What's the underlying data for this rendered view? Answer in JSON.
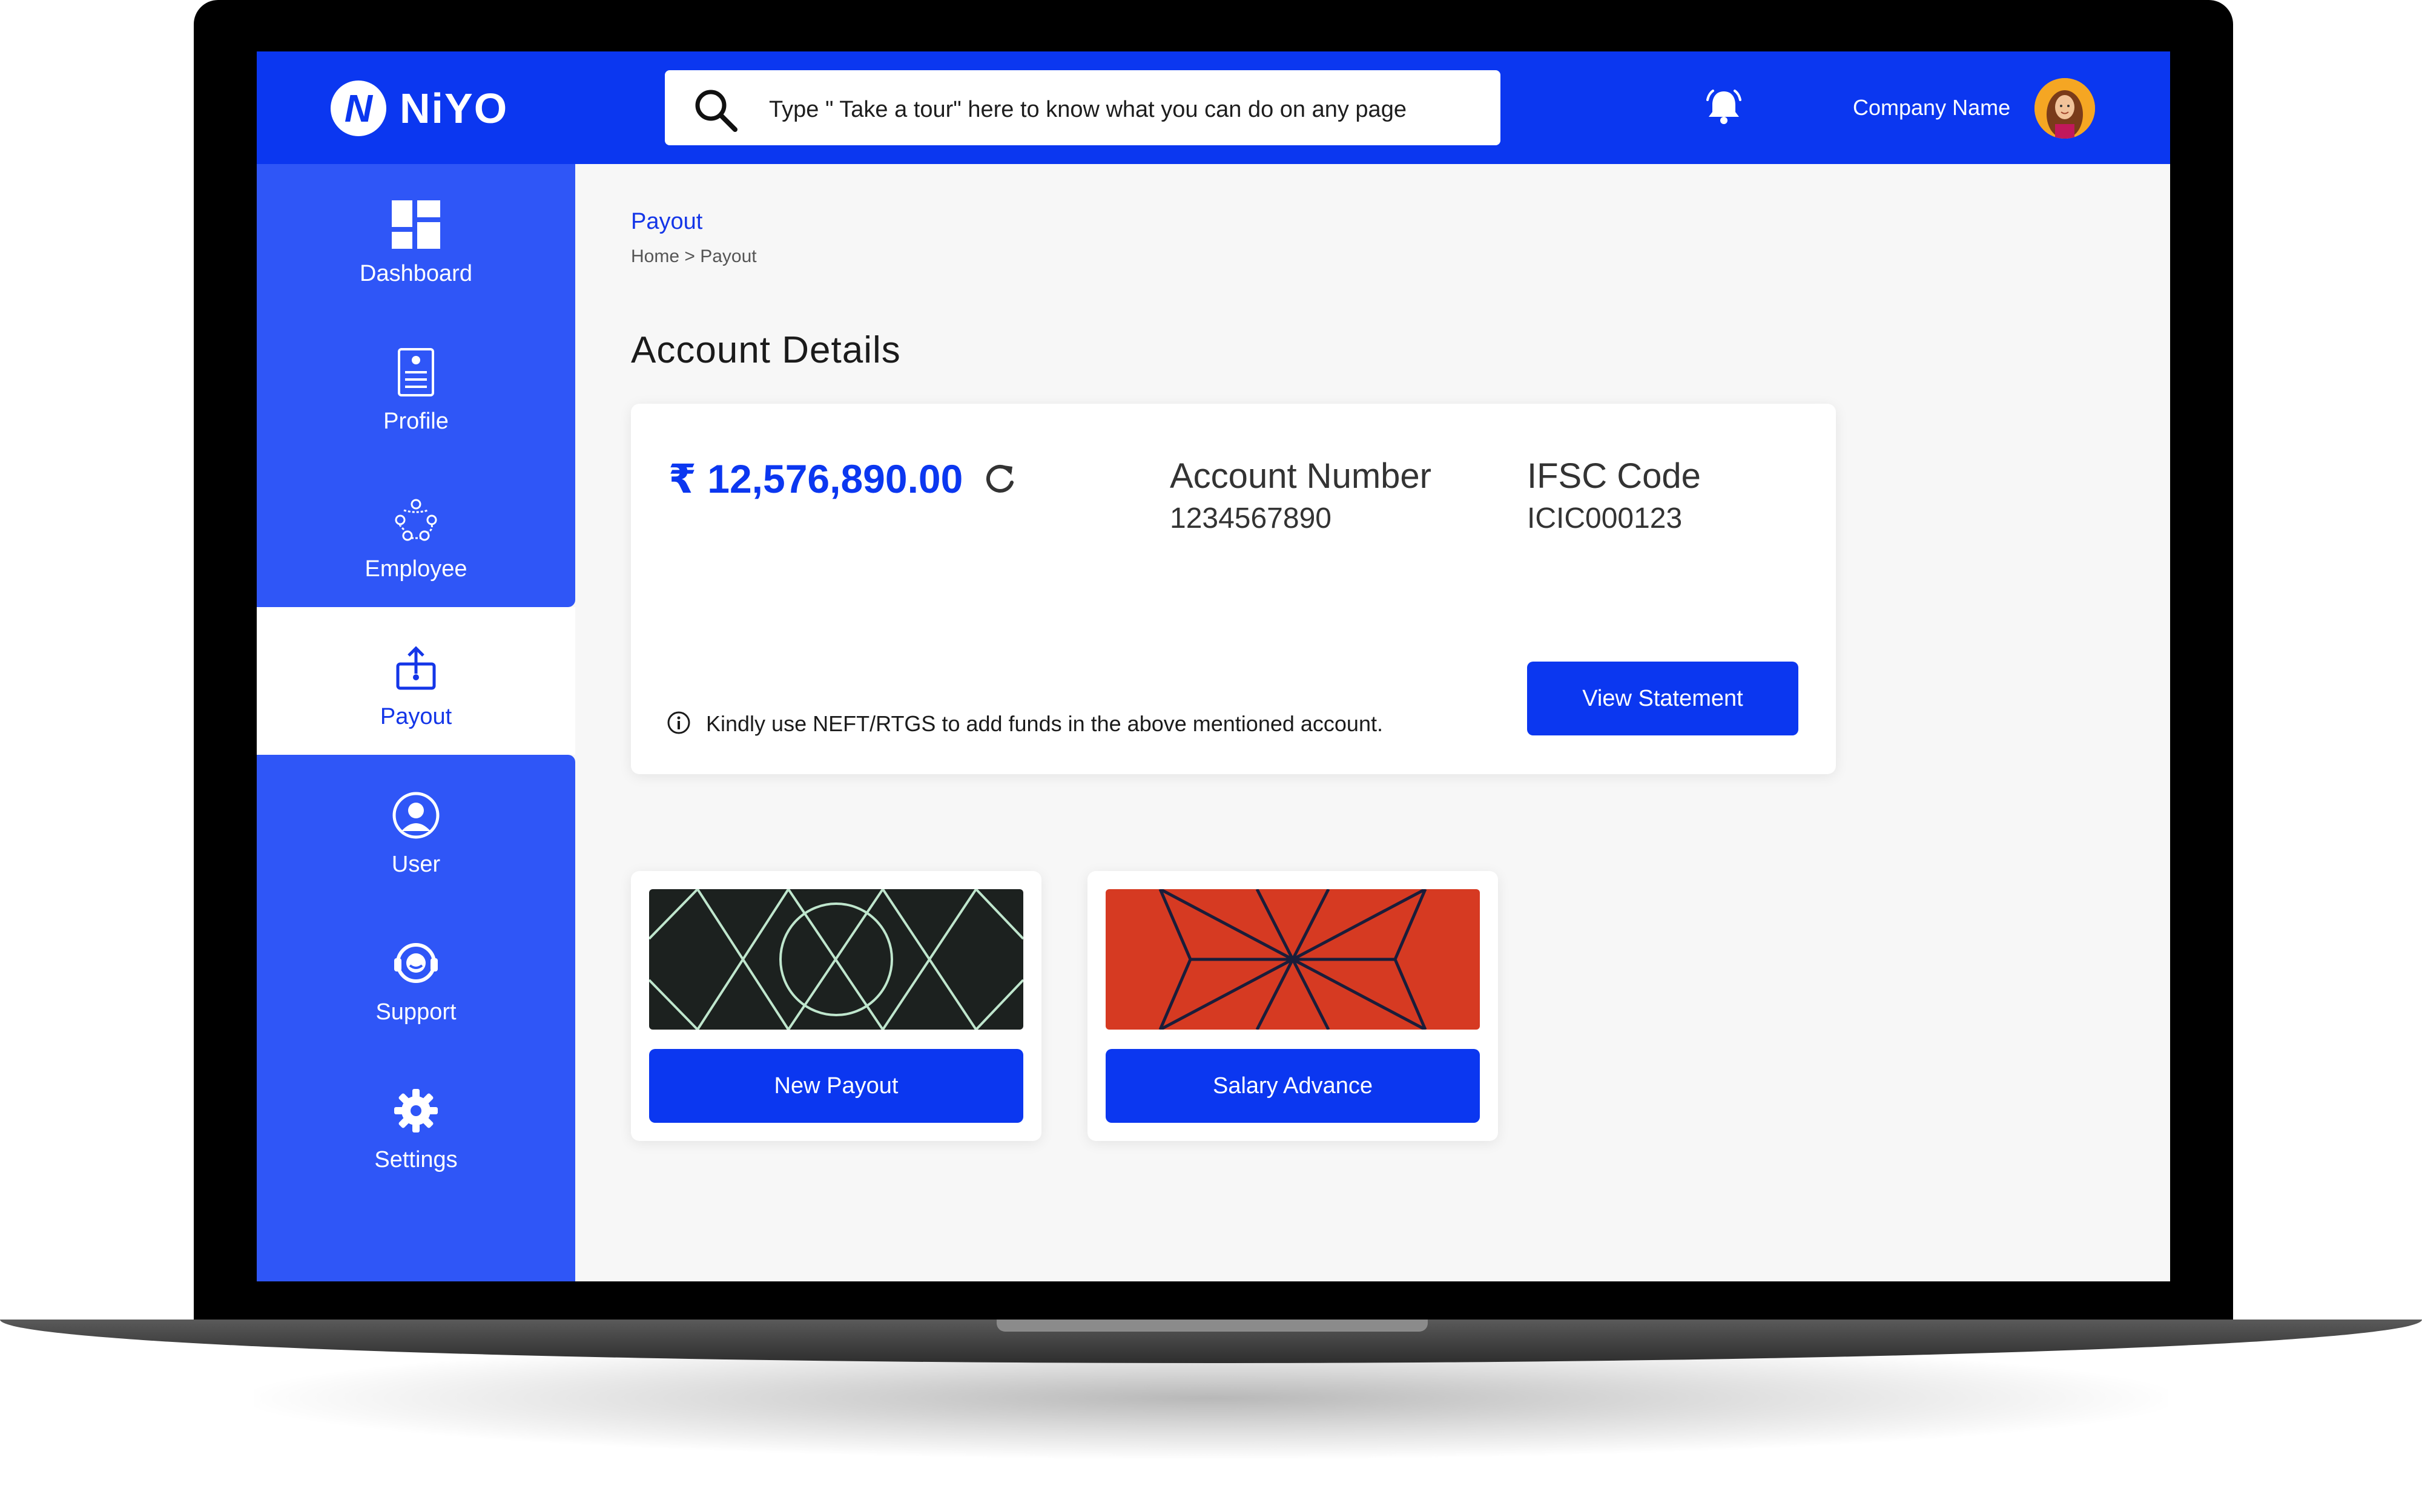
{
  "colors": {
    "brand_blue": "#0b37f0",
    "sidebar_blue": "#2f56f7",
    "dark_tile": "#1c211f",
    "red_tile": "#d63a22"
  },
  "header": {
    "logo_mark": "N",
    "logo_text": "NiYO",
    "search_placeholder": "Type \" Take a tour\" here to know what you can do on any page",
    "company_name": "Company Name",
    "icons": {
      "search": "search-icon",
      "notifications": "bell-icon",
      "avatar": "user-avatar"
    }
  },
  "sidebar": {
    "items": [
      {
        "label": "Dashboard",
        "icon": "dashboard-icon",
        "active": false
      },
      {
        "label": "Profile",
        "icon": "profile-document-icon",
        "active": false
      },
      {
        "label": "Employee",
        "icon": "employee-network-icon",
        "active": false
      },
      {
        "label": "Payout",
        "icon": "payout-box-icon",
        "active": true
      },
      {
        "label": "User",
        "icon": "user-circle-icon",
        "active": false
      },
      {
        "label": "Support",
        "icon": "headset-icon",
        "active": false
      },
      {
        "label": "Settings",
        "icon": "gear-icon",
        "active": false
      }
    ]
  },
  "page": {
    "title": "Payout",
    "breadcrumb": "Home > Payout",
    "section_title": "Account Details"
  },
  "account": {
    "balance": "₹ 12,576,890.00",
    "account_number_label": "Account Number",
    "account_number": "1234567890",
    "ifsc_label": "IFSC Code",
    "ifsc": "ICIC000123",
    "info_text": "Kindly use NEFT/RTGS to add funds in the above mentioned account.",
    "view_statement": "View Statement"
  },
  "actions": [
    {
      "label": "New Payout"
    },
    {
      "label": "Salary Advance"
    }
  ]
}
